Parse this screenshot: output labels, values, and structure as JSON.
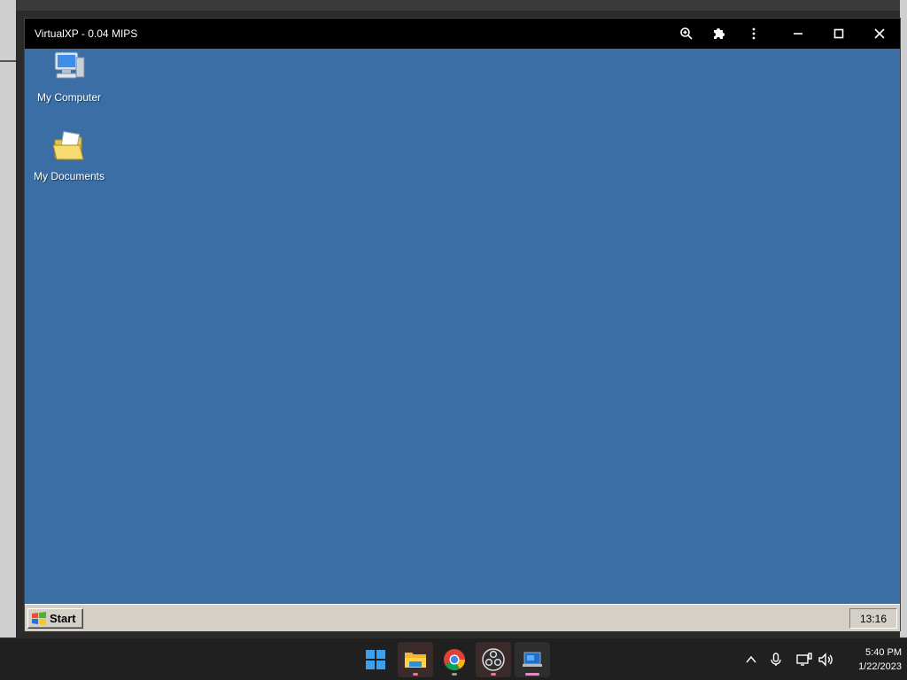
{
  "window": {
    "title": "VirtualXP - 0.04 MIPS"
  },
  "desktop": {
    "icons": [
      {
        "label": "My Computer"
      },
      {
        "label": "My Documents"
      }
    ]
  },
  "xp_taskbar": {
    "start_label": "Start",
    "clock": "13:16"
  },
  "host_taskbar": {
    "time": "5:40 PM",
    "date": "1/22/2023",
    "apps": [
      "windows-start-icon",
      "file-explorer-icon",
      "chrome-icon",
      "obs-icon",
      "virtualxp-app-icon"
    ]
  },
  "colors": {
    "xp_desktop": "#3a6ea5",
    "titlebar": "#000000",
    "host_taskbar": "#202020"
  }
}
